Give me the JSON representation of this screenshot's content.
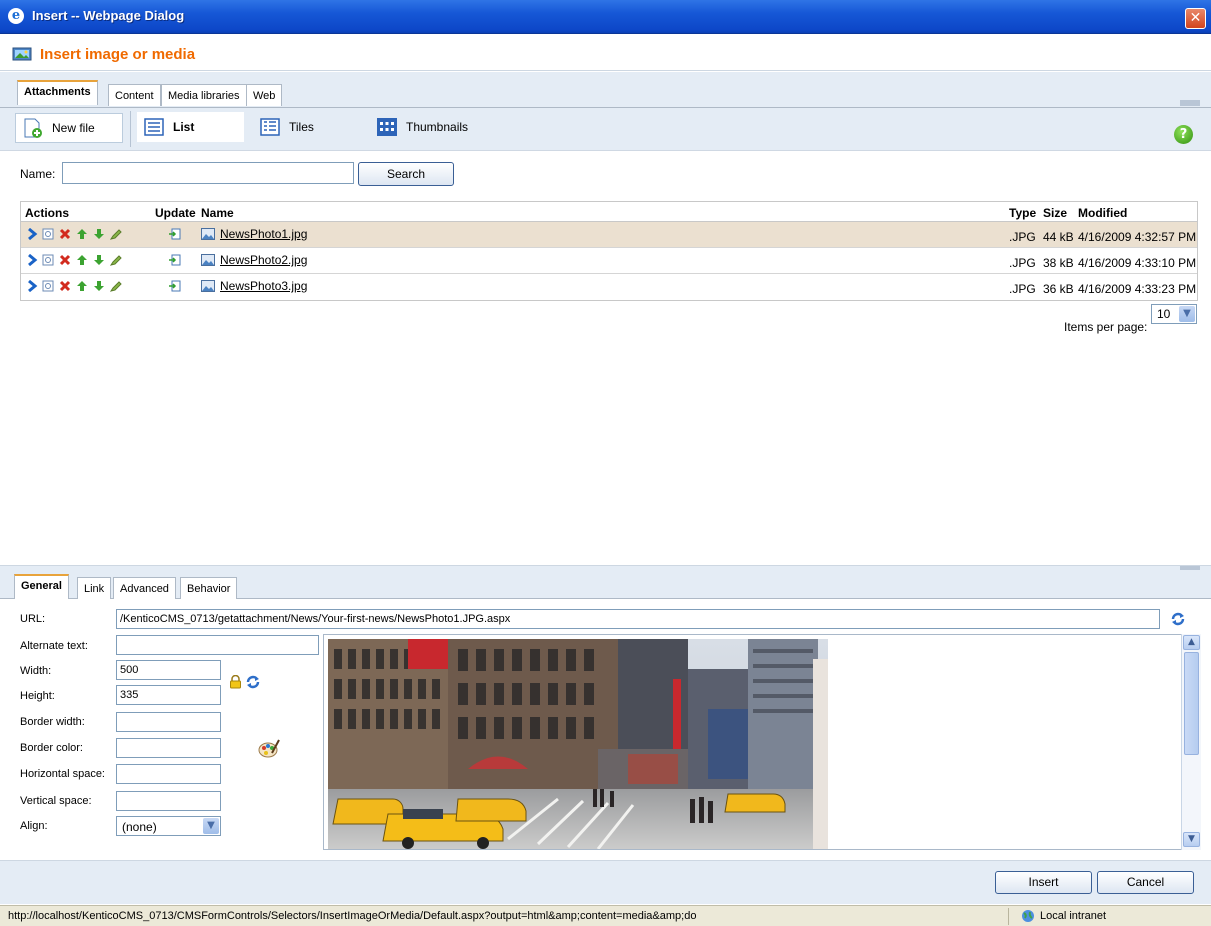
{
  "window": {
    "title": "Insert -- Webpage Dialog"
  },
  "header": {
    "title": "Insert image or media"
  },
  "top_tabs": [
    {
      "label": "Attachments",
      "active": true
    },
    {
      "label": "Content",
      "active": false
    },
    {
      "label": "Media libraries",
      "active": false
    },
    {
      "label": "Web",
      "active": false
    }
  ],
  "toolbar": {
    "new_file": "New file",
    "views": [
      {
        "label": "List",
        "selected": true,
        "icon": "list-icon"
      },
      {
        "label": "Tiles",
        "selected": false,
        "icon": "tiles-icon"
      },
      {
        "label": "Thumbnails",
        "selected": false,
        "icon": "thumbnails-icon"
      }
    ],
    "help": "?"
  },
  "search": {
    "label": "Name:",
    "value": "",
    "button": "Search"
  },
  "grid": {
    "headers": {
      "actions": "Actions",
      "update": "Update",
      "name": "Name",
      "type": "Type",
      "size": "Size",
      "modified": "Modified"
    },
    "rows": [
      {
        "name": "NewsPhoto1.jpg",
        "type": ".JPG",
        "size": "44 kB",
        "modified": "4/16/2009 4:32:57 PM",
        "highlighted": true
      },
      {
        "name": "NewsPhoto2.jpg",
        "type": ".JPG",
        "size": "38 kB",
        "modified": "4/16/2009 4:33:10 PM",
        "highlighted": false
      },
      {
        "name": "NewsPhoto3.jpg",
        "type": ".JPG",
        "size": "36 kB",
        "modified": "4/16/2009 4:33:23 PM",
        "highlighted": false
      }
    ],
    "items_per_page_label": "Items per page:",
    "items_per_page": "10"
  },
  "bottom_tabs": [
    {
      "label": "General",
      "active": true
    },
    {
      "label": "Link",
      "active": false
    },
    {
      "label": "Advanced",
      "active": false
    },
    {
      "label": "Behavior",
      "active": false
    }
  ],
  "properties": {
    "url_label": "URL:",
    "url": "/KenticoCMS_0713/getattachment/News/Your-first-news/NewsPhoto1.JPG.aspx",
    "alt_label": "Alternate text:",
    "alt": "",
    "width_label": "Width:",
    "width": "500",
    "height_label": "Height:",
    "height": "335",
    "border_width_label": "Border width:",
    "border_width": "",
    "border_color_label": "Border color:",
    "border_color": "",
    "hspace_label": "Horizontal space:",
    "hspace": "",
    "vspace_label": "Vertical space:",
    "vspace": "",
    "align_label": "Align:",
    "align": "(none)"
  },
  "footer": {
    "insert": "Insert",
    "cancel": "Cancel"
  },
  "status": {
    "url": "http://localhost/KenticoCMS_0713/CMSFormControls/Selectors/InsertImageOrMedia/Default.aspx?output=html&amp;content=media&amp;do",
    "zone": "Local intranet"
  },
  "colors": {
    "accent": "#f06a00",
    "titlebar": "#1657d6",
    "highlight_row": "#ebe0d0",
    "panel": "#e4ecf5"
  }
}
